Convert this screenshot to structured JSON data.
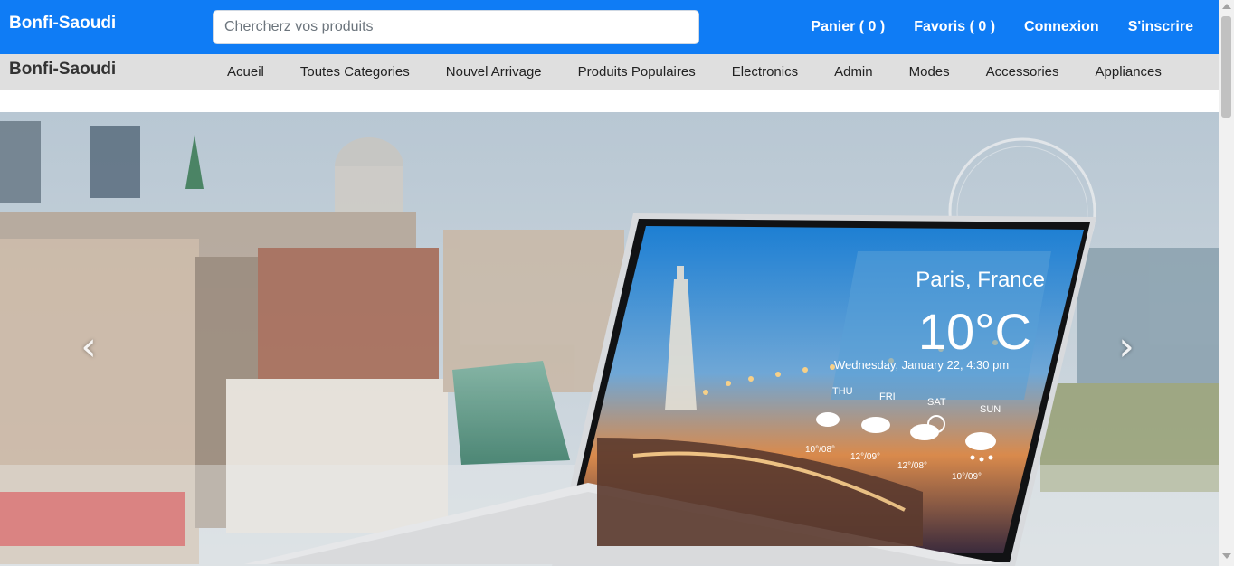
{
  "header": {
    "brand": "Bonfi-Saoudi",
    "search_placeholder": "Chercherz vos produits",
    "links": {
      "cart": "Panier ( 0 )",
      "favorites": "Favoris ( 0 )",
      "login": "Connexion",
      "register": "S'inscrire"
    }
  },
  "subnav": {
    "brand": "Bonfi-Saoudi",
    "items": [
      "Acueil",
      "Toutes Categories",
      "Nouvel Arrivage",
      "Produits Populaires",
      "Electronics",
      "Admin",
      "Modes",
      "Accessories",
      "Appliances"
    ]
  },
  "carousel": {
    "prev_icon": "chevron-left-icon",
    "next_icon": "chevron-right-icon",
    "slide": {
      "weather": {
        "city": "Paris, France",
        "temp": "10°C",
        "date": "Wednesday, January 22, 4:30 pm",
        "days": [
          "THU",
          "FRI",
          "SAT",
          "SUN"
        ],
        "ranges": [
          "10°/08°",
          "12°/09°",
          "12°/08°",
          "10°/09°"
        ]
      }
    }
  },
  "colors": {
    "topbar": "#0f7cf5",
    "subnav": "#dfdfdf"
  }
}
